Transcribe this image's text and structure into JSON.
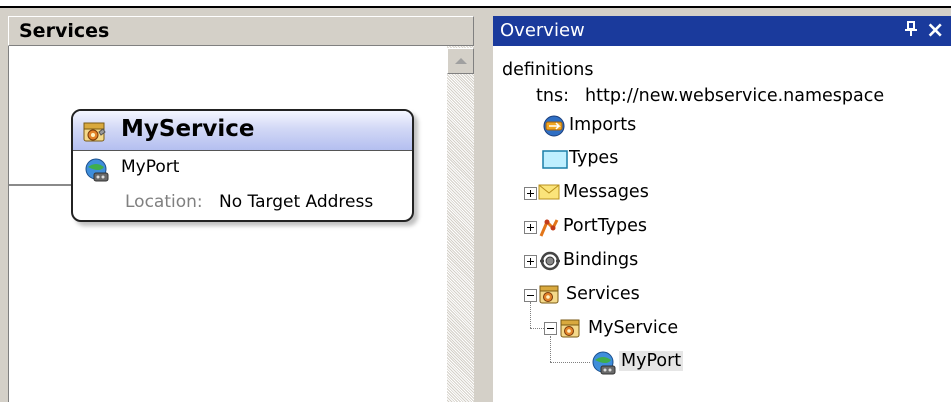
{
  "left_panel": {
    "title": "Services",
    "service_box": {
      "name": "MyService",
      "port": "MyPort",
      "location_label": "Location:",
      "location_value": "No Target Address"
    }
  },
  "overview": {
    "title": "Overview",
    "pin_label": "ᵃ",
    "close_label": "×",
    "tree": {
      "root": "definitions",
      "tns_label": "tns:",
      "tns_value": "http://new.webservice.namespace",
      "imports": "Imports",
      "types": "Types",
      "messages": "Messages",
      "porttypes": "PortTypes",
      "bindings": "Bindings",
      "services": "Services",
      "myservice": "MyService",
      "myport": "MyPort"
    }
  },
  "icons": [
    "service-gear-icon",
    "port-globe-icon",
    "imports-icon",
    "types-icon",
    "messages-envelope-icon",
    "porttypes-icon",
    "bindings-icon",
    "pin-icon",
    "close-icon"
  ],
  "colors": {
    "overview_header": "#1a3a9c",
    "service_header_gradient_end": "#b4bff0"
  }
}
